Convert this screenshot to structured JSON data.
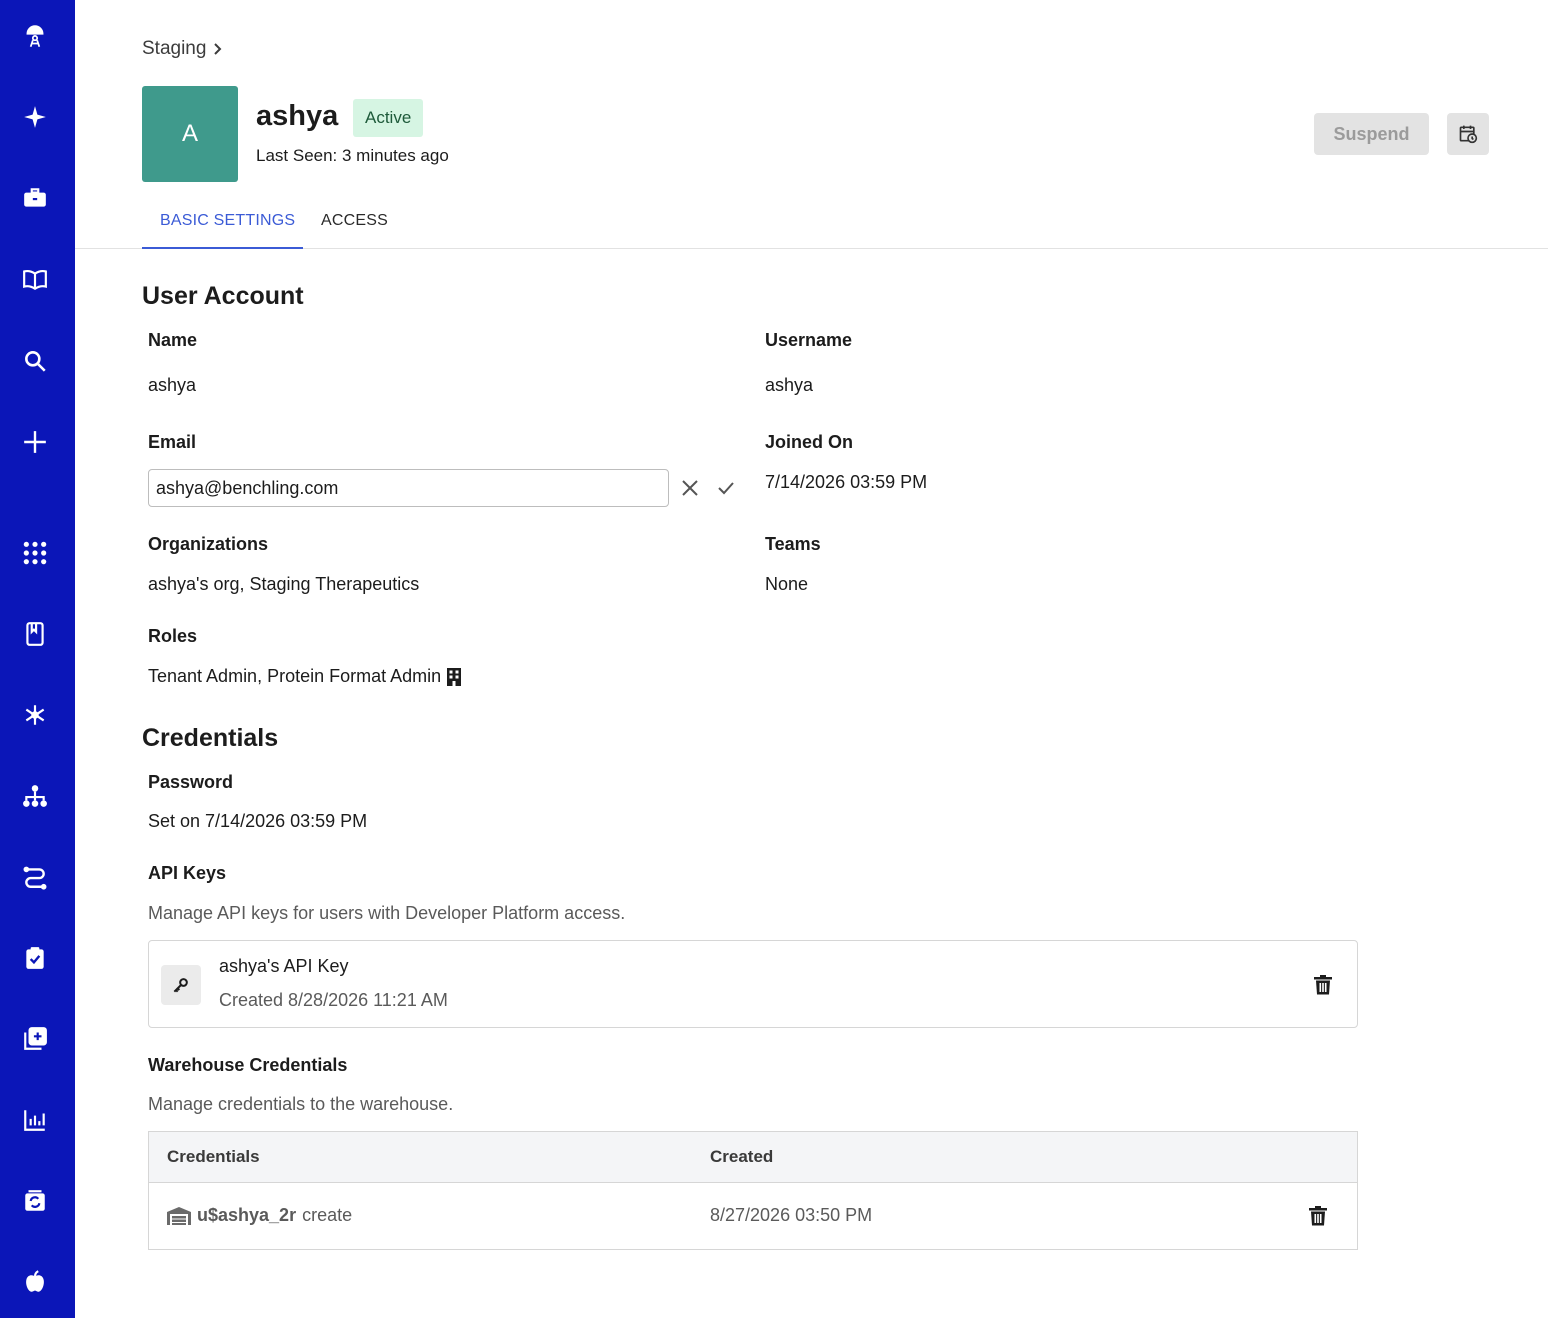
{
  "sidebar": {
    "items": [
      {
        "name": "app-logo-icon"
      },
      {
        "name": "sparkle-icon"
      },
      {
        "name": "briefcase-icon"
      },
      {
        "name": "book-icon"
      },
      {
        "name": "search-icon"
      },
      {
        "name": "plus-icon"
      },
      {
        "name": "apps-grid-icon"
      },
      {
        "name": "notebook-icon"
      },
      {
        "name": "molecule-icon"
      },
      {
        "name": "hierarchy-icon"
      },
      {
        "name": "workflow-icon"
      },
      {
        "name": "clipboard-check-icon"
      },
      {
        "name": "add-library-icon"
      },
      {
        "name": "chart-icon"
      },
      {
        "name": "sync-icon"
      },
      {
        "name": "apple-icon"
      }
    ],
    "color": "#0b16b8"
  },
  "breadcrumb": {
    "label": "Staging"
  },
  "user": {
    "avatar_letter": "A",
    "name": "ashya",
    "status": "Active",
    "last_seen": "Last Seen: 3 minutes ago"
  },
  "actions": {
    "suspend_label": "Suspend"
  },
  "tabs": [
    {
      "label": "BASIC SETTINGS",
      "active": true
    },
    {
      "label": "ACCESS",
      "active": false
    }
  ],
  "user_account": {
    "title": "User Account",
    "name_label": "Name",
    "name_value": "ashya",
    "username_label": "Username",
    "username_value": "ashya",
    "email_label": "Email",
    "email_value": "ashya@benchling.com",
    "joined_label": "Joined On",
    "joined_value": "7/14/2026 03:59 PM",
    "orgs_label": "Organizations",
    "orgs_value": "ashya's org, Staging Therapeutics",
    "teams_label": "Teams",
    "teams_value": "None",
    "roles_label": "Roles",
    "roles_value": "Tenant Admin, Protein Format Admin"
  },
  "credentials": {
    "title": "Credentials",
    "password_label": "Password",
    "password_value": "Set on 7/14/2026 03:59 PM",
    "api_keys_label": "API Keys",
    "api_keys_desc": "Manage API keys for users with Developer Platform access.",
    "api_key": {
      "name": "ashya's API Key",
      "created": "Created 8/28/2026 11:21 AM"
    },
    "warehouse_label": "Warehouse Credentials",
    "warehouse_desc": "Manage credentials to the warehouse.",
    "warehouse_table": {
      "columns": [
        "Credentials",
        "Created"
      ],
      "rows": [
        {
          "username": "u$ashya_2r",
          "permission": "create",
          "created": "8/27/2026 03:50 PM"
        }
      ]
    }
  },
  "colors": {
    "accent": "#3b5bd6",
    "avatar": "#3f9a8c",
    "status_bg": "#d6f5e3"
  }
}
